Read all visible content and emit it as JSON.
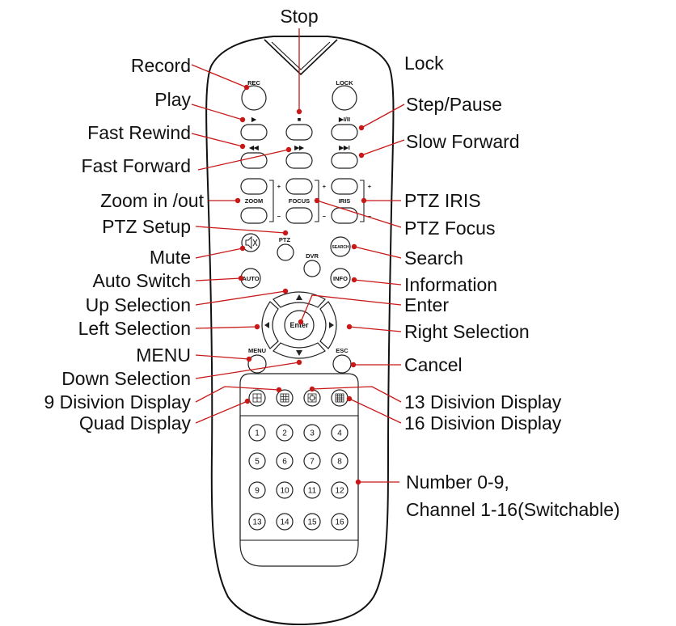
{
  "callouts": {
    "stop": "Stop",
    "record": "Record",
    "lock": "Lock",
    "play": "Play",
    "step_pause": "Step/Pause",
    "fast_rewind": "Fast  Rewind",
    "slow_forward": "Slow  Forward",
    "fast_forward": "Fast Forward",
    "zoom": "Zoom in /out",
    "ptz_iris": "PTZ IRIS",
    "ptz_setup": "PTZ Setup",
    "ptz_focus": "PTZ Focus",
    "mute": "Mute",
    "search": "Search",
    "auto_switch": "Auto Switch",
    "information": "Information",
    "up_selection": "Up Selection",
    "enter": "Enter",
    "left_selection": "Left  Selection",
    "right_selection": "Right  Selection",
    "menu": "MENU",
    "cancel": "Cancel",
    "down_selection": "Down  Selection",
    "div9": "9 Disivion Display",
    "div13": "13 Disivion Display",
    "quad": "Quad Display",
    "div16": "16 Disivion Display",
    "number_line1": "Number 0-9,",
    "number_line2": "Channel 1-16(Switchable)"
  },
  "buttons": {
    "rec": "REC",
    "lock": "LOCK",
    "zoom": "ZOOM",
    "focus": "FOCUS",
    "iris": "IRIS",
    "ptz": "PTZ",
    "dvr": "DVR",
    "search": "SEARCH",
    "auto": "AUTO",
    "info": "INFO",
    "enter": "Enter",
    "menu": "MENU",
    "esc": "ESC",
    "plus": "+",
    "minus": "−",
    "play_sym": "▶",
    "stop_sym": "■",
    "step_sym": "▶I/II",
    "rew_sym": "◀◀",
    "ff_sym": "▶▶",
    "slow_sym": "▶▶I"
  },
  "numbers": [
    "1",
    "2",
    "3",
    "4",
    "5",
    "6",
    "7",
    "8",
    "9",
    "10",
    "11",
    "12",
    "13",
    "14",
    "15",
    "16"
  ],
  "icons": {
    "mute": "speaker-muted-icon",
    "quad": "grid-4-icon",
    "div9": "grid-9-icon",
    "div13": "grid-13-icon",
    "div16": "grid-16-icon",
    "arrows": "direction-arrow-icons"
  },
  "colors": {
    "leader": "#c81818",
    "text": "#111111",
    "outline": "#222222"
  }
}
